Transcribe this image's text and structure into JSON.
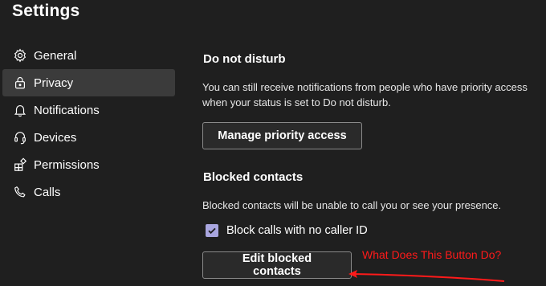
{
  "header": {
    "title": "Settings"
  },
  "sidebar": {
    "items": [
      {
        "label": "General",
        "icon": "gear-icon",
        "active": false
      },
      {
        "label": "Privacy",
        "icon": "lock-icon",
        "active": true
      },
      {
        "label": "Notifications",
        "icon": "bell-icon",
        "active": false
      },
      {
        "label": "Devices",
        "icon": "headset-icon",
        "active": false
      },
      {
        "label": "Permissions",
        "icon": "apps-icon",
        "active": false
      },
      {
        "label": "Calls",
        "icon": "phone-icon",
        "active": false
      }
    ]
  },
  "main": {
    "dnd": {
      "heading": "Do not disturb",
      "description_line1": "You can still receive notifications from people who have priority access",
      "description_line2": "when your status is set to Do not disturb.",
      "button_label": "Manage priority access"
    },
    "blocked": {
      "heading": "Blocked contacts",
      "description": "Blocked contacts will be unable to call you or see your presence.",
      "checkbox_label": "Block calls with no caller ID",
      "checkbox_checked": true,
      "button_label": "Edit blocked contacts"
    }
  },
  "annotation": {
    "text": "What Does This Button Do?",
    "color": "#ff1a1a"
  },
  "colors": {
    "background": "#1f1f1f",
    "active_item": "#3b3b3b",
    "checkbox": "#a9a6df",
    "button_border": "#8a8a8a"
  }
}
